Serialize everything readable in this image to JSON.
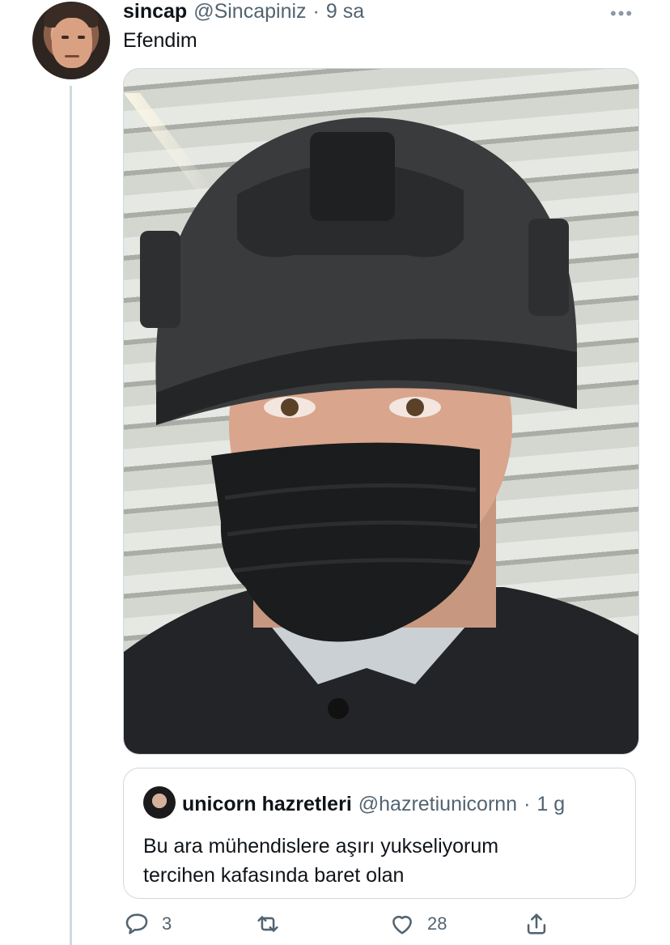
{
  "tweet": {
    "author_name": "sincap",
    "author_handle": "@Sincapiniz",
    "separator": "·",
    "time": "9 sa",
    "text": "Efendim",
    "more_icon": "more-icon"
  },
  "media": {
    "subject": "Selfie photo: helmet and black face mask"
  },
  "quoted_tweet": {
    "author_name": "unicorn hazretleri",
    "author_handle": "@hazretiunicornn",
    "separator": "·",
    "time": "1 g",
    "text_lines": [
      "Bu ara mühendislere aşırı yukseliyorum",
      "tercihen kafasında baret olan"
    ]
  },
  "actions": {
    "reply_count": "3",
    "retweet_count": "",
    "like_count": "28",
    "icons": [
      "reply-icon",
      "retweet-icon",
      "like-icon",
      "share-icon"
    ]
  }
}
